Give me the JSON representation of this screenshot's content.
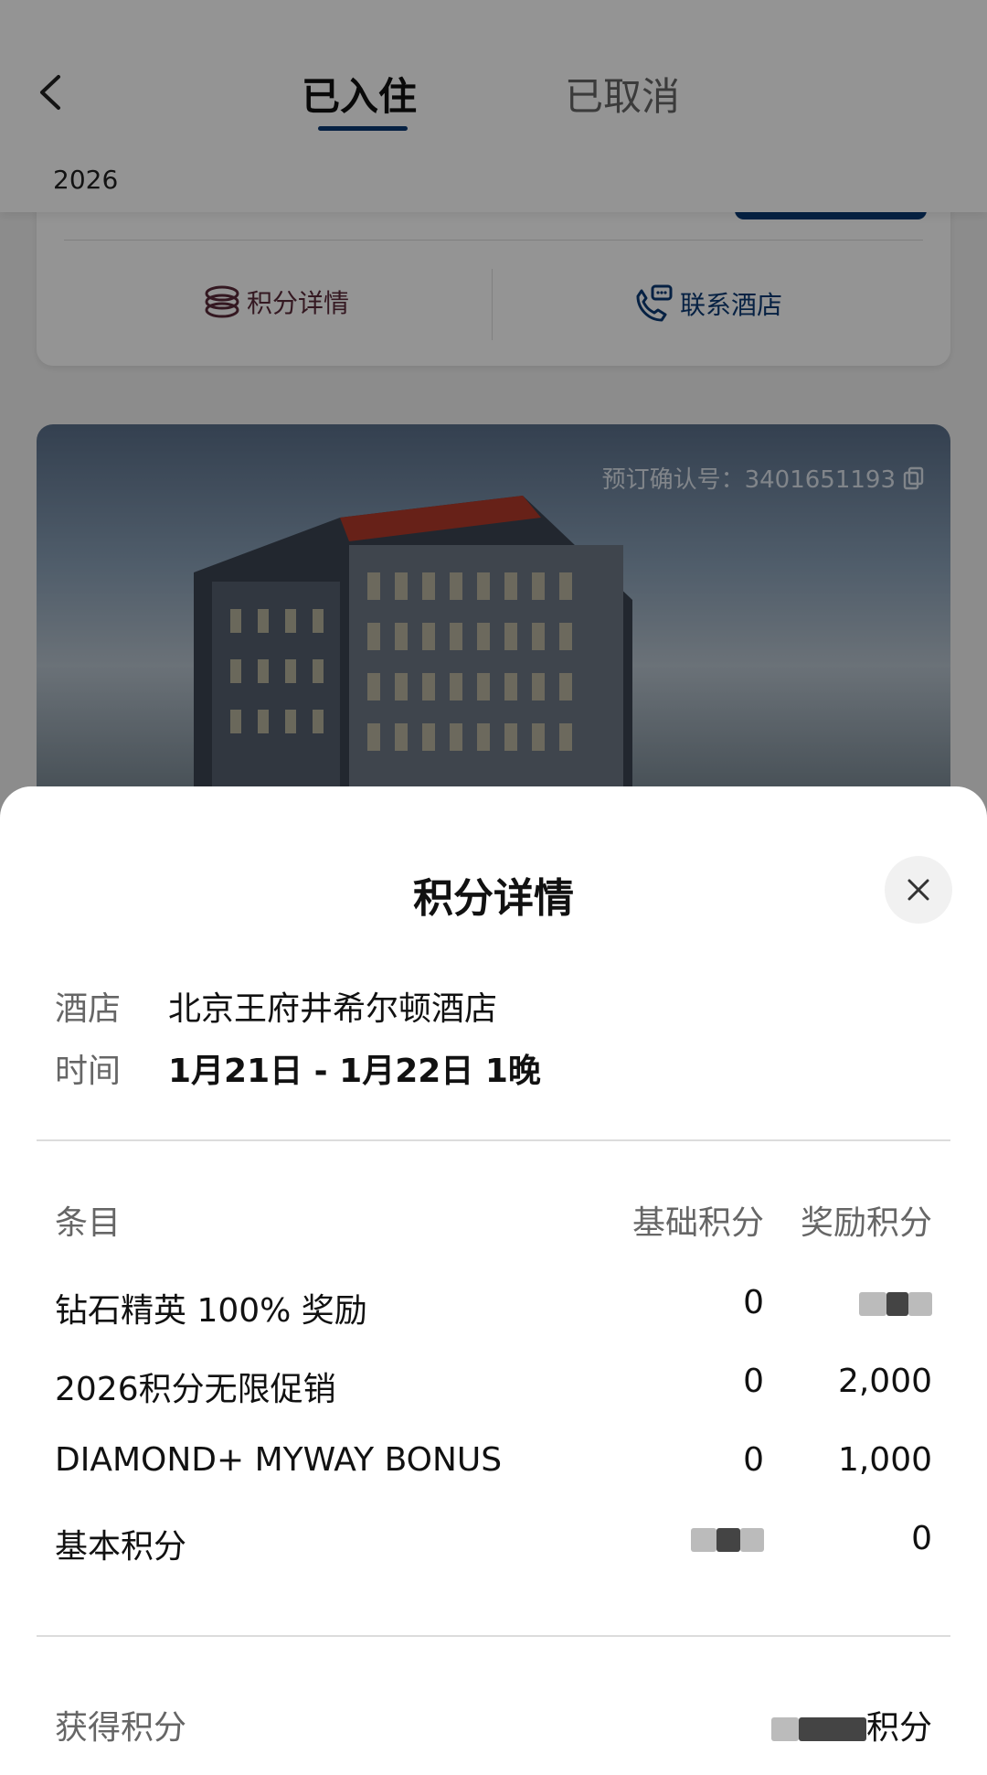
{
  "header": {
    "tabs": [
      {
        "label": "已入住",
        "active": true
      },
      {
        "label": "已取消",
        "active": false
      }
    ],
    "year": "2026"
  },
  "card1": {
    "actions": [
      {
        "label": "积分详情",
        "icon": "coins-icon"
      },
      {
        "label": "联系酒店",
        "icon": "phone-chat-icon"
      }
    ]
  },
  "card2": {
    "confirmation_label": "预订确认号：3401651193",
    "copy_icon": "copy-icon"
  },
  "sheet": {
    "title": "积分详情",
    "hotel_label": "酒店",
    "hotel_value": "北京王府井希尔顿酒店",
    "time_label": "时间",
    "time_value": "1月21日 - 1月22日 1晚",
    "table": {
      "headers": [
        "条目",
        "基础积分",
        "奖励积分"
      ],
      "rows": [
        {
          "item": "钻石精英 100% 奖励",
          "base": "0",
          "bonus": ""
        },
        {
          "item": "2026积分无限促销",
          "base": "0",
          "bonus": "2,000"
        },
        {
          "item": "DIAMOND+ MYWAY BONUS",
          "base": "0",
          "bonus": "1,000"
        },
        {
          "item": "基本积分",
          "base": "",
          "bonus": "0"
        }
      ]
    },
    "total_label": "获得积分",
    "total_suffix": "积分"
  },
  "colors": {
    "brand_navy": "#0b3a74",
    "points_maroon": "#5a2a3a"
  }
}
